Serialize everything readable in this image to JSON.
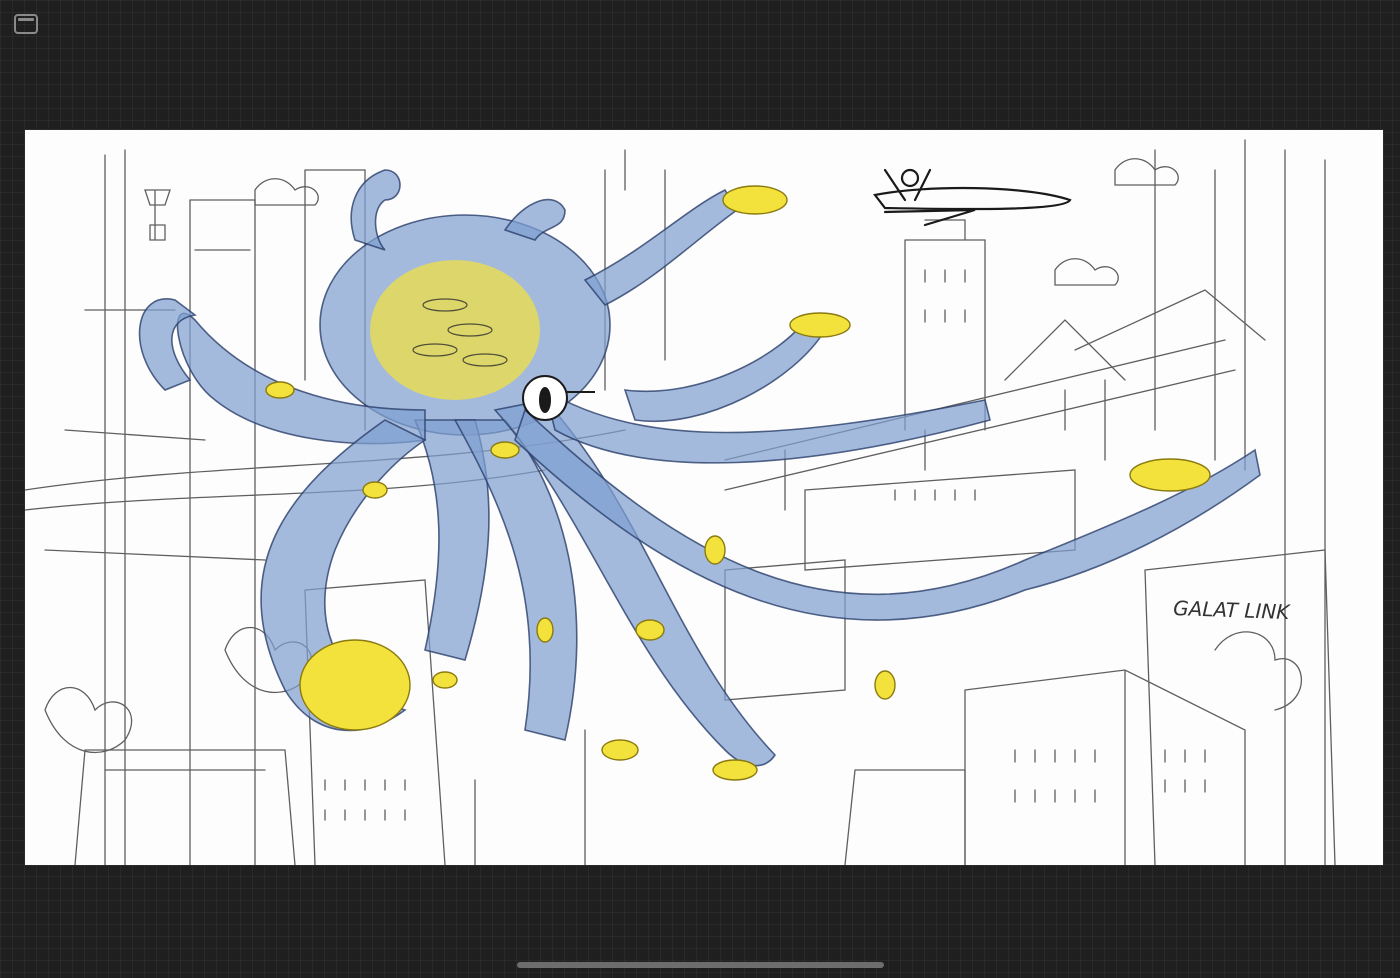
{
  "toolbar": {
    "sidebar_toggle_icon": "sidebar-icon"
  },
  "canvas": {
    "sign_text": "GALAT LINK",
    "colors": {
      "background": "#1f1f1f",
      "paper": "#fdfdfd",
      "octopus": "#7f9fd0",
      "coin": "#f3e23b",
      "sketch": "#2b2b2b"
    }
  }
}
